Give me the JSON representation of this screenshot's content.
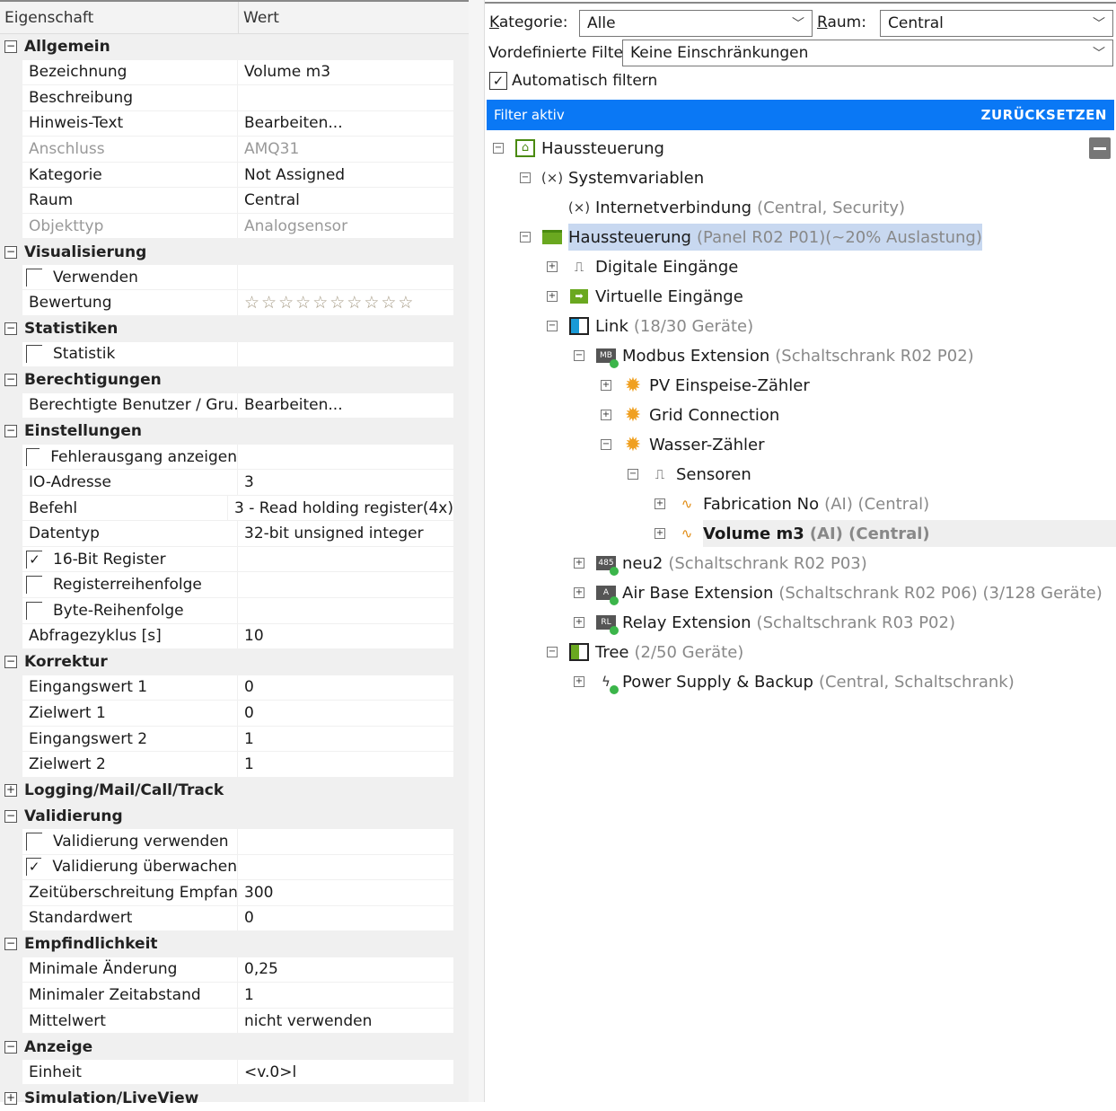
{
  "properties": {
    "header": {
      "col1": "Eigenschaft",
      "col2": "Wert"
    },
    "sections": [
      {
        "title": "Allgemein",
        "expanded": true,
        "rows": [
          {
            "label": "Bezeichnung",
            "value": "Volume m3"
          },
          {
            "label": "Beschreibung",
            "value": ""
          },
          {
            "label": "Hinweis-Text",
            "value": "Bearbeiten..."
          },
          {
            "label": "Anschluss",
            "value": "AMQ31",
            "disabled": true
          },
          {
            "label": "Kategorie",
            "value": "Not Assigned"
          },
          {
            "label": "Raum",
            "value": "Central"
          },
          {
            "label": "Objekttyp",
            "value": "Analogsensor",
            "disabled": true
          }
        ]
      },
      {
        "title": "Visualisierung",
        "expanded": true,
        "rows": [
          {
            "label": "Verwenden",
            "checkbox": true,
            "checked": false,
            "value": ""
          },
          {
            "label": "Bewertung",
            "stars": 10,
            "rating": 0,
            "value": ""
          }
        ]
      },
      {
        "title": "Statistiken",
        "expanded": true,
        "rows": [
          {
            "label": "Statistik",
            "checkbox": true,
            "checked": false,
            "value": ""
          }
        ]
      },
      {
        "title": "Berechtigungen",
        "expanded": true,
        "rows": [
          {
            "label": "Berechtigte Benutzer / Gru...",
            "value": "Bearbeiten..."
          }
        ]
      },
      {
        "title": "Einstellungen",
        "expanded": true,
        "rows": [
          {
            "label": "Fehlerausgang anzeigen",
            "checkbox": true,
            "checked": false,
            "value": ""
          },
          {
            "label": "IO-Adresse",
            "value": "3"
          },
          {
            "label": "Befehl",
            "value": "3 - Read holding register(4x)"
          },
          {
            "label": "Datentyp",
            "value": "32-bit unsigned integer"
          },
          {
            "label": "16-Bit Register",
            "checkbox": true,
            "checked": true,
            "value": ""
          },
          {
            "label": "Registerreihenfolge",
            "checkbox": true,
            "checked": false,
            "value": ""
          },
          {
            "label": "Byte-Reihenfolge",
            "checkbox": true,
            "checked": false,
            "value": ""
          },
          {
            "label": "Abfragezyklus [s]",
            "value": "10"
          }
        ]
      },
      {
        "title": "Korrektur",
        "expanded": true,
        "rows": [
          {
            "label": "Eingangswert 1",
            "value": "0"
          },
          {
            "label": "Zielwert 1",
            "value": "0"
          },
          {
            "label": "Eingangswert 2",
            "value": "1"
          },
          {
            "label": "Zielwert 2",
            "value": "1"
          }
        ]
      },
      {
        "title": "Logging/Mail/Call/Track",
        "expanded": false,
        "rows": []
      },
      {
        "title": "Validierung",
        "expanded": true,
        "rows": [
          {
            "label": "Validierung verwenden",
            "checkbox": true,
            "checked": false,
            "value": ""
          },
          {
            "label": "Validierung überwachen",
            "checkbox": true,
            "checked": true,
            "value": ""
          },
          {
            "label": "Zeitüberschreitung Empfang",
            "value": "300"
          },
          {
            "label": "Standardwert",
            "value": "0"
          }
        ]
      },
      {
        "title": "Empfindlichkeit",
        "expanded": true,
        "rows": [
          {
            "label": "Minimale Änderung",
            "value": "0,25"
          },
          {
            "label": "Minimaler Zeitabstand",
            "value": "1"
          },
          {
            "label": "Mittelwert",
            "value": "nicht verwenden"
          }
        ]
      },
      {
        "title": "Anzeige",
        "expanded": true,
        "rows": [
          {
            "label": "Einheit",
            "value": "<v.0>l"
          }
        ]
      },
      {
        "title": "Simulation/LiveView",
        "expanded": false,
        "rows": []
      }
    ]
  },
  "filters": {
    "kategorie_label": "Kategorie:",
    "kategorie_value": "Alle",
    "raum_label": "Raum:",
    "raum_value": "Central",
    "vordefiniert_label": "Vordefinierte Filter",
    "vordefiniert_value": "Keine Einschränkungen",
    "auto_filter_label": "Automatisch filtern",
    "auto_filter_checked": true,
    "status": "Filter aktiv",
    "reset_label": "ZURÜCKSETZEN",
    "accent": "#0a78f5"
  },
  "tree": [
    {
      "level": 0,
      "exp": "-",
      "icon": "house-icon",
      "name": "Haussteuerung",
      "detail": ""
    },
    {
      "level": 1,
      "exp": "-",
      "icon": "variable-icon",
      "name": "Systemvariablen",
      "detail": ""
    },
    {
      "level": 2,
      "exp": "",
      "icon": "variable-icon",
      "name": "Internetverbindung",
      "detail": "(Central, Security)"
    },
    {
      "level": 1,
      "exp": "-",
      "icon": "miniserver-icon",
      "name": "Haussteuerung",
      "detail": "(Panel R02 P01)(~20% Auslastung)",
      "highlight": true
    },
    {
      "level": 2,
      "exp": "+",
      "icon": "digital-input-icon",
      "name": "Digitale Eingänge",
      "detail": ""
    },
    {
      "level": 2,
      "exp": "+",
      "icon": "virtual-input-icon",
      "name": "Virtuelle Eingänge",
      "detail": ""
    },
    {
      "level": 2,
      "exp": "-",
      "icon": "link-icon",
      "name": "Link",
      "detail": "(18/30 Geräte)"
    },
    {
      "level": 3,
      "exp": "-",
      "icon": "modbus-extension-icon",
      "name": "Modbus Extension",
      "detail": "(Schaltschrank R02 P02)",
      "badge": "MB",
      "online": true
    },
    {
      "level": 4,
      "exp": "+",
      "icon": "meter-icon",
      "name": "PV Einspeise-Zähler",
      "detail": ""
    },
    {
      "level": 4,
      "exp": "+",
      "icon": "meter-icon",
      "name": "Grid Connection",
      "detail": ""
    },
    {
      "level": 4,
      "exp": "-",
      "icon": "meter-icon",
      "name": "Wasser-Zähler",
      "detail": ""
    },
    {
      "level": 5,
      "exp": "-",
      "icon": "digital-input-icon",
      "name": "Sensoren",
      "detail": ""
    },
    {
      "level": 6,
      "exp": "+",
      "icon": "analog-sensor-icon",
      "name": "Fabrication No",
      "detail": "(AI) (Central)"
    },
    {
      "level": 6,
      "exp": "+",
      "icon": "analog-sensor-icon",
      "name": "Volume m3",
      "detail": "(AI) (Central)",
      "selected": true
    },
    {
      "level": 3,
      "exp": "+",
      "icon": "rs485-extension-icon",
      "name": "neu2",
      "detail": "(Schaltschrank R02 P03)",
      "badge": "485",
      "online": true
    },
    {
      "level": 3,
      "exp": "+",
      "icon": "air-base-extension-icon",
      "name": "Air Base Extension",
      "detail": "(Schaltschrank R02 P06) (3/128 Geräte)",
      "badge": "A",
      "online": true
    },
    {
      "level": 3,
      "exp": "+",
      "icon": "relay-extension-icon",
      "name": "Relay Extension",
      "detail": "(Schaltschrank R03 P02)",
      "badge": "RL",
      "online": true
    },
    {
      "level": 2,
      "exp": "-",
      "icon": "tree-icon",
      "name": "Tree",
      "detail": " (2/50 Geräte)"
    },
    {
      "level": 3,
      "exp": "+",
      "icon": "power-supply-icon",
      "name": "Power Supply & Backup",
      "detail": "(Central, Schaltschrank)",
      "online": true
    }
  ]
}
